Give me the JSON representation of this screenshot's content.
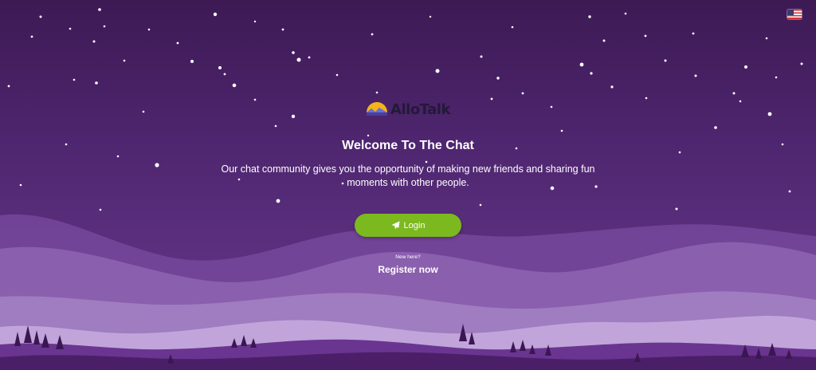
{
  "language": {
    "icon": "us-flag-icon",
    "label": ""
  },
  "brand": {
    "name": "AlloTalk",
    "logo_icon": "sunrise-mountain-icon"
  },
  "welcome": {
    "title": "Welcome To The Chat",
    "subtitle": "Our chat community gives you the opportunity of making new friends and sharing fun moments with other people."
  },
  "login": {
    "label": "Login",
    "icon": "paper-plane-icon",
    "color": "#7cb91f"
  },
  "register": {
    "prompt": "New here?",
    "link": "Register now"
  },
  "colors": {
    "sky_top": "#3d1a54",
    "sky_bottom": "#6a3a8e",
    "accent": "#7cb91f",
    "logo_sun": "#f4b41a"
  }
}
